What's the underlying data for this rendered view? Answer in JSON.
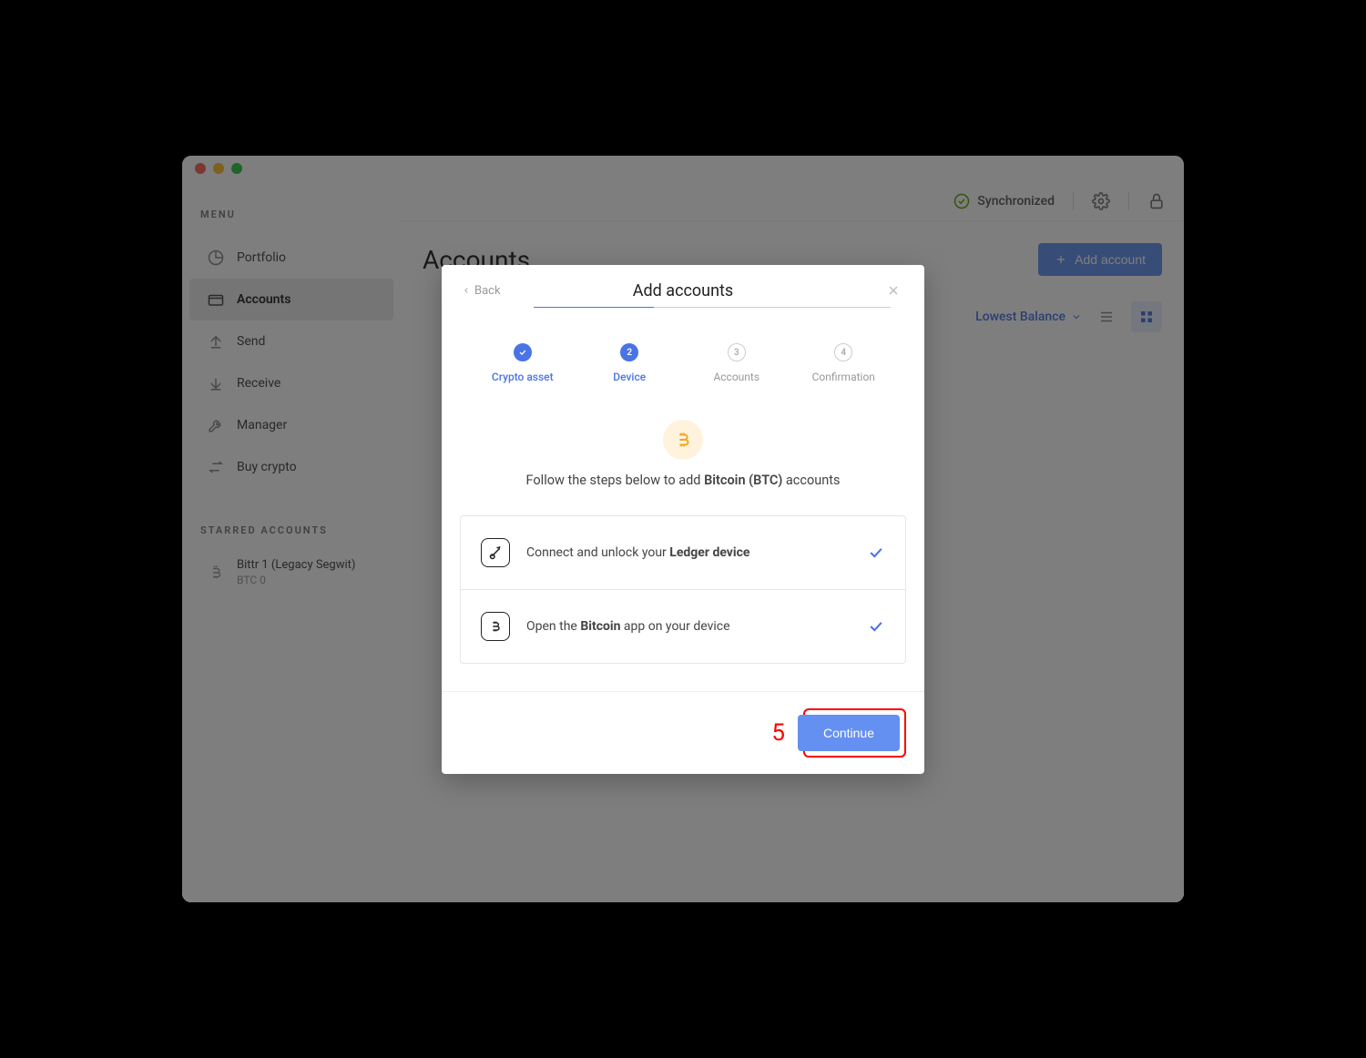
{
  "sidebar": {
    "menu_title": "MENU",
    "items": [
      {
        "label": "Portfolio"
      },
      {
        "label": "Accounts"
      },
      {
        "label": "Send"
      },
      {
        "label": "Receive"
      },
      {
        "label": "Manager"
      },
      {
        "label": "Buy crypto"
      }
    ],
    "starred_title": "STARRED ACCOUNTS",
    "starred": {
      "name": "Bittr 1 (Legacy Segwit)",
      "balance": "BTC 0"
    }
  },
  "topbar": {
    "sync_label": "Synchronized"
  },
  "page": {
    "title": "Accounts",
    "add_button": "Add account",
    "sort_label": "Lowest Balance"
  },
  "modal": {
    "back_label": "Back",
    "title": "Add accounts",
    "steps": [
      {
        "num": "✓",
        "label": "Crypto asset",
        "state": "done"
      },
      {
        "num": "2",
        "label": "Device",
        "state": "active"
      },
      {
        "num": "3",
        "label": "Accounts",
        "state": "pending"
      },
      {
        "num": "4",
        "label": "Confirmation",
        "state": "pending"
      }
    ],
    "instruction_prefix": "Follow the steps below to add ",
    "instruction_asset": "Bitcoin (BTC)",
    "instruction_suffix": " accounts",
    "checklist": [
      {
        "text_prefix": "Connect and unlock your ",
        "text_bold": "Ledger device",
        "text_suffix": ""
      },
      {
        "text_prefix": "Open the ",
        "text_bold": "Bitcoin",
        "text_suffix": " app on your device"
      }
    ],
    "continue_label": "Continue",
    "annotation": "5"
  }
}
